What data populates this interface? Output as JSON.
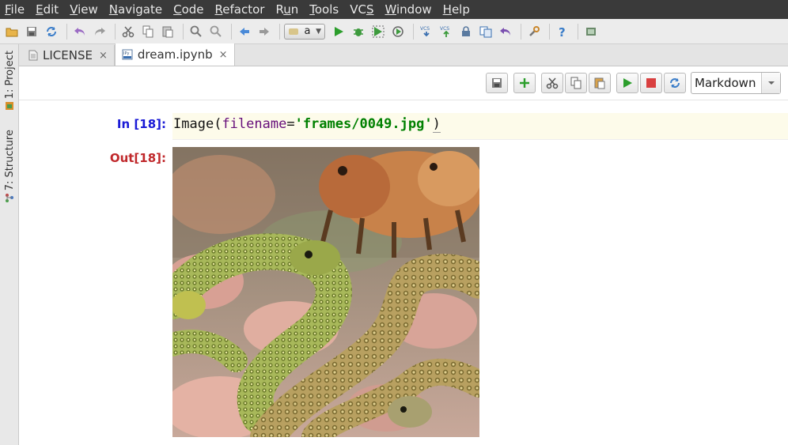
{
  "menubar": {
    "items": [
      {
        "mnemonic": "F",
        "rest": "ile"
      },
      {
        "mnemonic": "E",
        "rest": "dit"
      },
      {
        "mnemonic": "V",
        "rest": "iew"
      },
      {
        "mnemonic": "N",
        "rest": "avigate"
      },
      {
        "mnemonic": "C",
        "rest": "ode"
      },
      {
        "mnemonic": "R",
        "rest": "efactor"
      },
      {
        "pre": "R",
        "mnemonic": "u",
        "rest": "n"
      },
      {
        "mnemonic": "T",
        "rest": "ools"
      },
      {
        "pre": "VC",
        "mnemonic": "S",
        "rest": ""
      },
      {
        "mnemonic": "W",
        "rest": "indow"
      },
      {
        "mnemonic": "H",
        "rest": "elp"
      }
    ]
  },
  "toolbar": {
    "run_config_label": "a"
  },
  "sidebar": {
    "project_label": "1: Project",
    "structure_label": "7: Structure"
  },
  "tabs": [
    {
      "label": "LICENSE",
      "close": "×"
    },
    {
      "label": "dream.ipynb",
      "close": "×"
    }
  ],
  "notebook_toolbar": {
    "cell_type": "Markdown"
  },
  "cell": {
    "in_prompt": "In [18]:",
    "out_prompt": "Out[18]:",
    "code": {
      "func": "Image",
      "open_paren": "(",
      "kwarg": "filename",
      "eq": "=",
      "string": "'frames/0049.jpg'",
      "close_paren": ")"
    }
  },
  "colors": {
    "in_prompt": "#1a1ad6",
    "out_prompt": "#c0282b",
    "string": "#008000",
    "keyword_arg": "#660e7a",
    "code_bg": "#fdfbea"
  }
}
